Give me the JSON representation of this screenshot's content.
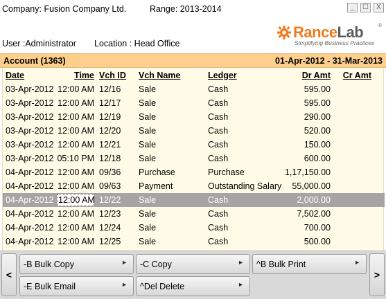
{
  "header": {
    "company": "Company: Fusion Company Ltd.",
    "range": "Range: 2013-2014",
    "user": "User :Administrator",
    "location": "Location : Head Office",
    "window_controls": [
      "_",
      "☐",
      "X"
    ]
  },
  "logo": {
    "rance": "Rance",
    "lab": "Lab",
    "reg": "®",
    "tagline": "Simplifying Business Practices",
    "icon": "gear-icon",
    "colors": {
      "orange": "#f07a1e",
      "gray": "#5a5a5a"
    }
  },
  "account": {
    "title": "Account (1363)",
    "period": "01-Apr-2012 - 31-Mar-2013",
    "bar_color": "#fccf8c"
  },
  "table": {
    "headers": {
      "date": "Date",
      "time": "Time",
      "vch_id": "Vch ID",
      "vch_name": "Vch Name",
      "ledger": "Ledger",
      "dr_amt": "Dr Amt",
      "cr_amt": "Cr Amt"
    },
    "rows": [
      {
        "date": "03-Apr-2012",
        "time": "12:00 AM",
        "vch_id": "12/16",
        "vch_name": "Sale",
        "ledger": "Cash",
        "dr_amt": "595.00",
        "cr_amt": ""
      },
      {
        "date": "03-Apr-2012",
        "time": "12:00 AM",
        "vch_id": "12/17",
        "vch_name": "Sale",
        "ledger": "Cash",
        "dr_amt": "595.00",
        "cr_amt": ""
      },
      {
        "date": "03-Apr-2012",
        "time": "12:00 AM",
        "vch_id": "12/19",
        "vch_name": "Sale",
        "ledger": "Cash",
        "dr_amt": "290.00",
        "cr_amt": ""
      },
      {
        "date": "03-Apr-2012",
        "time": "12:00 AM",
        "vch_id": "12/20",
        "vch_name": "Sale",
        "ledger": "Cash",
        "dr_amt": "520.00",
        "cr_amt": ""
      },
      {
        "date": "03-Apr-2012",
        "time": "12:00 AM",
        "vch_id": "12/21",
        "vch_name": "Sale",
        "ledger": "Cash",
        "dr_amt": "150.00",
        "cr_amt": ""
      },
      {
        "date": "03-Apr-2012",
        "time": "05:10 PM",
        "vch_id": "12/18",
        "vch_name": "Sale",
        "ledger": "Cash",
        "dr_amt": "600.00",
        "cr_amt": ""
      },
      {
        "date": "04-Apr-2012",
        "time": "12:00 AM",
        "vch_id": "09/36",
        "vch_name": "Purchase",
        "ledger": "Purchase",
        "dr_amt": "1,17,150.00",
        "cr_amt": ""
      },
      {
        "date": "04-Apr-2012",
        "time": "12:00 AM",
        "vch_id": "09/63",
        "vch_name": "Payment",
        "ledger": "Outstanding Salary",
        "dr_amt": "55,000.00",
        "cr_amt": ""
      },
      {
        "date": "04-Apr-2012",
        "time": "12:00 AM",
        "vch_id": "12/22",
        "vch_name": "Sale",
        "ledger": "Cash",
        "dr_amt": "2,000.00",
        "cr_amt": ""
      },
      {
        "date": "04-Apr-2012",
        "time": "12:00 AM",
        "vch_id": "12/23",
        "vch_name": "Sale",
        "ledger": "Cash",
        "dr_amt": "7,502.00",
        "cr_amt": ""
      },
      {
        "date": "04-Apr-2012",
        "time": "12:00 AM",
        "vch_id": "12/24",
        "vch_name": "Sale",
        "ledger": "Cash",
        "dr_amt": "700.00",
        "cr_amt": ""
      },
      {
        "date": "04-Apr-2012",
        "time": "12:00 AM",
        "vch_id": "12/25",
        "vch_name": "Sale",
        "ledger": "Cash",
        "dr_amt": "500.00",
        "cr_amt": ""
      }
    ],
    "selected_row": 8,
    "selected_color": "#a5a5a5"
  },
  "toolbar": {
    "prev": "<",
    "next": ">",
    "buttons": [
      {
        "label": "-B Bulk Copy",
        "arrow": "►"
      },
      {
        "label": "-C Copy",
        "arrow": "►"
      },
      {
        "label": "^B Bulk Print",
        "arrow": "►"
      },
      {
        "label": "-E Bulk Email",
        "arrow": "►"
      },
      {
        "label": "^Del Delete",
        "arrow": "►"
      }
    ]
  }
}
